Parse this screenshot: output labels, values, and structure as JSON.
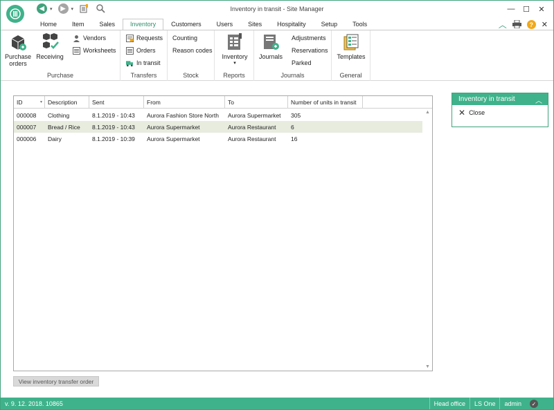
{
  "window": {
    "title": "Inventory in transit - Site Manager"
  },
  "tabs": [
    {
      "label": "Home"
    },
    {
      "label": "Item"
    },
    {
      "label": "Sales"
    },
    {
      "label": "Inventory",
      "active": true
    },
    {
      "label": "Customers"
    },
    {
      "label": "Users"
    },
    {
      "label": "Sites"
    },
    {
      "label": "Hospitality"
    },
    {
      "label": "Setup"
    },
    {
      "label": "Tools"
    }
  ],
  "ribbon": {
    "purchase": {
      "label": "Purchase",
      "purchase_orders_line1": "Purchase",
      "purchase_orders_line2": "orders",
      "receiving": "Receiving",
      "vendors": "Vendors",
      "worksheets": "Worksheets"
    },
    "transfers": {
      "label": "Transfers",
      "requests": "Requests",
      "orders": "Orders",
      "in_transit": "In transit"
    },
    "stock": {
      "label": "Stock",
      "counting": "Counting",
      "reason_codes": "Reason codes"
    },
    "reports": {
      "label": "Reports",
      "inventory": "Inventory",
      "dropdown_mark": "▾"
    },
    "journals": {
      "label": "Journals",
      "journals": "Journals",
      "adjustments": "Adjustments",
      "reservations": "Reservations",
      "parked": "Parked"
    },
    "general": {
      "label": "General",
      "templates": "Templates"
    }
  },
  "table": {
    "columns": [
      "ID",
      "Description",
      "Sent",
      "From",
      "To",
      "Number of units in transit"
    ],
    "rows": [
      {
        "id": "000008",
        "description": "Clothing",
        "sent": "8.1.2019 - 10:43",
        "from": "Aurora Fashion Store North",
        "to": "Aurora Supermarket",
        "units": "305"
      },
      {
        "id": "000007",
        "description": "Bread / Rice",
        "sent": "8.1.2019 - 10:43",
        "from": "Aurora Supermarket",
        "to": "Aurora Restaurant",
        "units": "6",
        "selected": true
      },
      {
        "id": "000006",
        "description": "Dairy",
        "sent": "8.1.2019 - 10:39",
        "from": "Aurora Supermarket",
        "to": "Aurora Restaurant",
        "units": "16"
      }
    ]
  },
  "buttons": {
    "view_transfer_order": "View inventory transfer order"
  },
  "side_panel": {
    "title": "Inventory in transit",
    "close": "Close"
  },
  "status": {
    "version": "v. 9. 12. 2018. 10865",
    "head_office": "Head office",
    "product": "LS One",
    "user": "admin"
  },
  "colors": {
    "accent": "#3fb28b",
    "selected_row": "#e8ecdf",
    "active_tab_text": "#2e8f6c",
    "help_icon": "#f0a81c"
  }
}
